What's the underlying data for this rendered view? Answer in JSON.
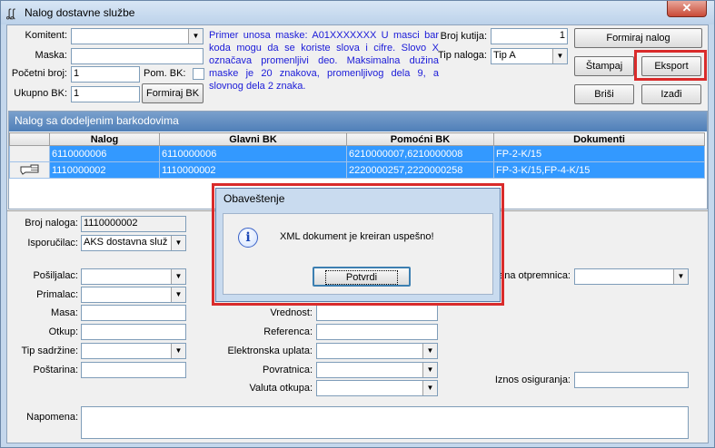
{
  "window": {
    "title": "Nalog dostavne službe",
    "close_symbol": "✕"
  },
  "top_form": {
    "komitent_label": "Komitent:",
    "komitent_value": "",
    "maska_label": "Maska:",
    "maska_value": "",
    "pocetni_broj_label": "Početni broj:",
    "pocetni_broj_value": "1",
    "pom_bk_label": "Pom. BK:",
    "ukupno_bk_label": "Ukupno BK:",
    "ukupno_bk_value": "1",
    "formiraj_bk_label": "Formiraj BK",
    "hint": "Primer unosa maske: A01XXXXXXX U masci bar koda mogu da se koriste slova i cifre. Slovo X označava promenljivi deo. Maksimalna dužina maske je 20 znakova, promenljivog dela 9, a slovnog dela 2 znaka.",
    "broj_kutija_label": "Broj kutija:",
    "broj_kutija_value": "1",
    "tip_naloga_label": "Tip naloga:",
    "tip_naloga_value": "Tip A",
    "formiraj_nalog_label": "Formiraj nalog",
    "stampaj_label": "Štampaj",
    "eksport_label": "Eksport",
    "brisi_label": "Briši",
    "izadji_label": "Izađi"
  },
  "grid": {
    "title": "Nalog sa dodeljenim barkodovima",
    "columns": [
      "Nalog",
      "Glavni BK",
      "Pomoćni BK",
      "Dokumenti"
    ],
    "rows": [
      {
        "nalog": "6110000006",
        "glavni": "6110000006",
        "pomocni": "6210000007,6210000008",
        "dokumenti": "FP-2-K/15"
      },
      {
        "nalog": "1110000002",
        "glavni": "1110000002",
        "pomocni": "2220000257,2220000258",
        "dokumenti": "FP-3-K/15,FP-4-K/15"
      }
    ],
    "current_row_icon": "pointing-hand-icon"
  },
  "detail": {
    "broj_naloga_label": "Broj naloga:",
    "broj_naloga_value": "1110000002",
    "isporucilac_label": "Isporučilac:",
    "isporucilac_value": "AKS dostavna služ",
    "posiljalac_label": "Pošiljalac:",
    "primalac_label": "Primalac:",
    "masa_label": "Masa:",
    "otkup_label": "Otkup:",
    "tip_sadrzine_label": "Tip sadržine:",
    "postarina_label": "Poštarina:",
    "vrednost_label": "Vrednost:",
    "referenca_label": "Referenca:",
    "elektronska_uplata_label": "Elektronska uplata:",
    "povratnica_label": "Povratnica:",
    "valuta_otkupa_label": "Valuta otkupa:",
    "otpremnica_label": "ana otpremnica:",
    "iznos_osiguranja_label": "Iznos osiguranja:",
    "napomena_label": "Napomena:"
  },
  "dialog": {
    "title": "Obaveštenje",
    "message": "XML dokument je kreiran uspešno!",
    "button": "Potvrdi",
    "icon": "info-icon"
  },
  "colors": {
    "highlight": "#d92b2b",
    "selection": "#3399ff",
    "hint": "#1a1ad8"
  }
}
